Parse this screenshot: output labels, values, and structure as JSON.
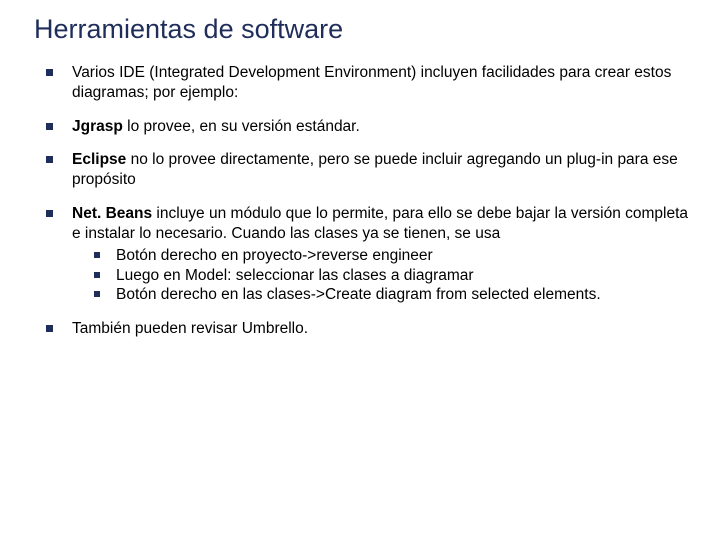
{
  "title": "Herramientas de software",
  "bullets": {
    "b1": "Varios IDE (Integrated Development Environment) incluyen facilidades para crear estos diagramas; por ejemplo:",
    "b2_bold": "Jgrasp",
    "b2_rest": " lo provee, en su versión estándar.",
    "b3_bold": "Eclipse",
    "b3_rest": " no lo provee directamente, pero se puede incluir agregando un plug-in para ese propósito",
    "b4_bold": "Net. Beans",
    "b4_rest": " incluye un módulo que lo permite, para ello se debe bajar la versión completa e instalar lo necesario. Cuando las clases ya se tienen, se usa",
    "b4_sub1": "Botón derecho en proyecto->reverse engineer",
    "b4_sub2": "Luego en Model: seleccionar las clases a diagramar",
    "b4_sub3": "Botón derecho en las clases->Create diagram from selected elements.",
    "b5": "También pueden revisar Umbrello."
  }
}
